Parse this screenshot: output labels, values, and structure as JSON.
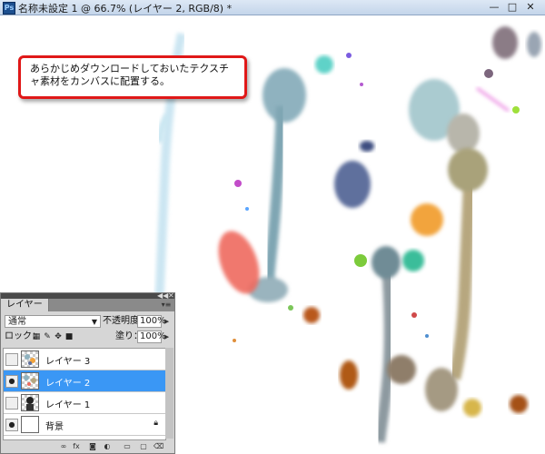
{
  "window": {
    "title": "名称未設定 1 @ 66.7% (レイヤー 2, RGB/8) *",
    "app_icon": "Ps",
    "minimize": "—",
    "maximize": "□",
    "close": "✕"
  },
  "callout": {
    "text": "あらかじめダウンロードしておいたテクスチャ素材をカンバスに配置する。",
    "border_color": "#e01818"
  },
  "layers_panel": {
    "tab_label": "レイヤー",
    "blend_mode": "通常",
    "opacity_label": "不透明度：",
    "opacity_value": "100%",
    "lock_label": "ロック：",
    "fill_label": "塗り：",
    "fill_value": "100%",
    "layers": [
      {
        "name": "レイヤー 3",
        "visible": false,
        "selected": false,
        "thumbnail": "texture"
      },
      {
        "name": "レイヤー 2",
        "visible": true,
        "selected": true,
        "thumbnail": "texture"
      },
      {
        "name": "レイヤー 1",
        "visible": false,
        "selected": false,
        "thumbnail": "person"
      },
      {
        "name": "背景",
        "visible": true,
        "selected": false,
        "thumbnail": "white",
        "locked": true
      }
    ],
    "footer_icons": [
      "link-icon",
      "fx-icon",
      "mask-icon",
      "adjustment-icon",
      "group-icon",
      "new-layer-icon",
      "trash-icon"
    ],
    "accent": "#3a97f5"
  }
}
